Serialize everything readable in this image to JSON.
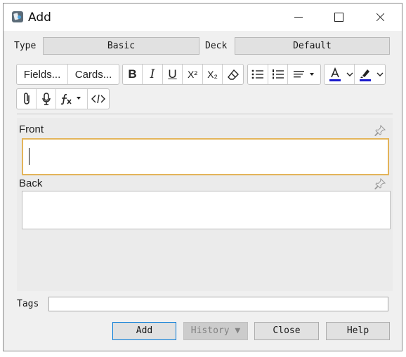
{
  "window": {
    "title": "Add"
  },
  "note_type": {
    "label": "Type",
    "value": "Basic"
  },
  "deck": {
    "label": "Deck",
    "value": "Default"
  },
  "toolbar": {
    "fields_label": "Fields...",
    "cards_label": "Cards...",
    "bold_label": "B",
    "italic_label": "I",
    "underline_label": "U",
    "superscript_label": "X²",
    "subscript_label": "X₂",
    "text_color": "#1a1acc",
    "highlight_color": "#1a1acc"
  },
  "fields": [
    {
      "name": "Front",
      "value": ""
    },
    {
      "name": "Back",
      "value": ""
    }
  ],
  "tags": {
    "label": "Tags",
    "value": ""
  },
  "buttons": {
    "add": "Add",
    "history": "History ▼",
    "close": "Close",
    "help": "Help"
  }
}
